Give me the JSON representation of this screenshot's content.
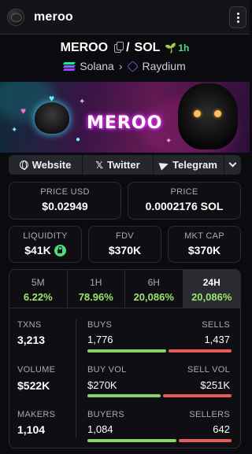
{
  "header": {
    "app_title": "meroo",
    "avatar_icon": "meroo-avatar",
    "menu_icon": "vertical-dots-icon"
  },
  "pair": {
    "base": "MEROO",
    "separator": "/",
    "quote": "SOL",
    "age": "1h",
    "chain": "Solana",
    "dex": "Raydium"
  },
  "banner": {
    "title": "MEROO"
  },
  "links": {
    "website": "Website",
    "twitter": "Twitter",
    "telegram": "Telegram"
  },
  "prices": {
    "usd_label": "PRICE USD",
    "usd_value": "$0.02949",
    "native_label": "PRICE",
    "native_value": "0.0002176 SOL"
  },
  "metrics": {
    "liquidity_label": "LIQUIDITY",
    "liquidity_value": "$41K",
    "fdv_label": "FDV",
    "fdv_value": "$370K",
    "mcap_label": "MKT CAP",
    "mcap_value": "$370K"
  },
  "periods": [
    {
      "label": "5M",
      "change": "6.22%"
    },
    {
      "label": "1H",
      "change": "78.96%"
    },
    {
      "label": "6H",
      "change": "20,086%"
    },
    {
      "label": "24H",
      "change": "20,086%",
      "active": true
    }
  ],
  "stats": {
    "txns_label": "TXNS",
    "txns_value": "3,213",
    "volume_label": "VOLUME",
    "volume_value": "$522K",
    "makers_label": "MAKERS",
    "makers_value": "1,104",
    "buys_label": "BUYS",
    "buys_value": "1,776",
    "sells_label": "SELLS",
    "sells_value": "1,437",
    "buy_vol_label": "BUY VOL",
    "buy_vol_value": "$270K",
    "sell_vol_label": "SELL VOL",
    "sell_vol_value": "$251K",
    "buyers_label": "BUYERS",
    "buyers_value": "1,084",
    "sellers_label": "SELLERS",
    "sellers_value": "642",
    "buys_ratio": 0.553,
    "buy_vol_ratio": 0.518,
    "buyers_ratio": 0.628
  },
  "colors": {
    "accent_green": "#4ade80",
    "change_green": "#9ae66e",
    "bar_green": "#86d46a",
    "bar_red": "#e55a5a",
    "background": "#0b0b0f"
  }
}
